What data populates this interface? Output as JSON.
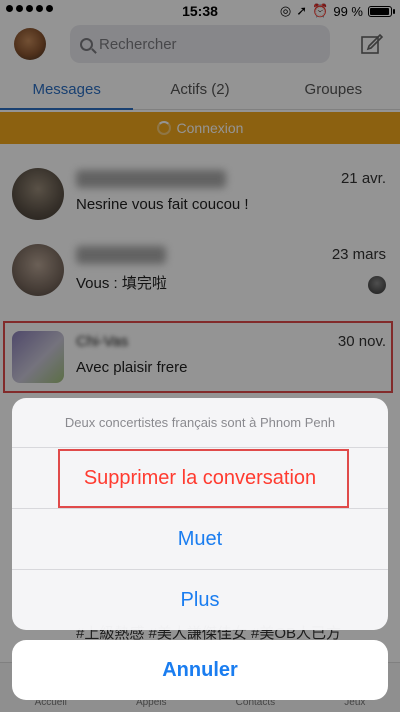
{
  "status": {
    "time": "15:38",
    "battery": "99 %",
    "battery_level": 0.99
  },
  "header": {
    "search_placeholder": "Rechercher"
  },
  "tabs": [
    {
      "label": "Messages"
    },
    {
      "label": "Actifs (2)"
    },
    {
      "label": "Groupes"
    }
  ],
  "banner": {
    "text": "Connexion"
  },
  "conversations": [
    {
      "name": "",
      "date": "21 avr.",
      "message": "Nesrine vous fait coucou !"
    },
    {
      "name": "",
      "date": "23 mars",
      "message": "Vous : 填完啦"
    },
    {
      "name": "Chi-Vas",
      "date": "30 nov.",
      "message": "Avec plaisir frere"
    }
  ],
  "bottom_nav": [
    "Accueil",
    "Appels",
    "Contacts",
    "Jeux"
  ],
  "action_sheet": {
    "title": "Deux concertistes français sont à Phnom Penh",
    "delete_label": "Supprimer la conversation",
    "mute_label": "Muet",
    "more_label": "Plus",
    "cancel_label": "Annuler"
  },
  "colors": {
    "accent": "#2b6fc3",
    "banner": "#f2a81d",
    "action": "#1a7df0",
    "destructive": "#ff3b30",
    "highlight": "#e04a4a"
  }
}
